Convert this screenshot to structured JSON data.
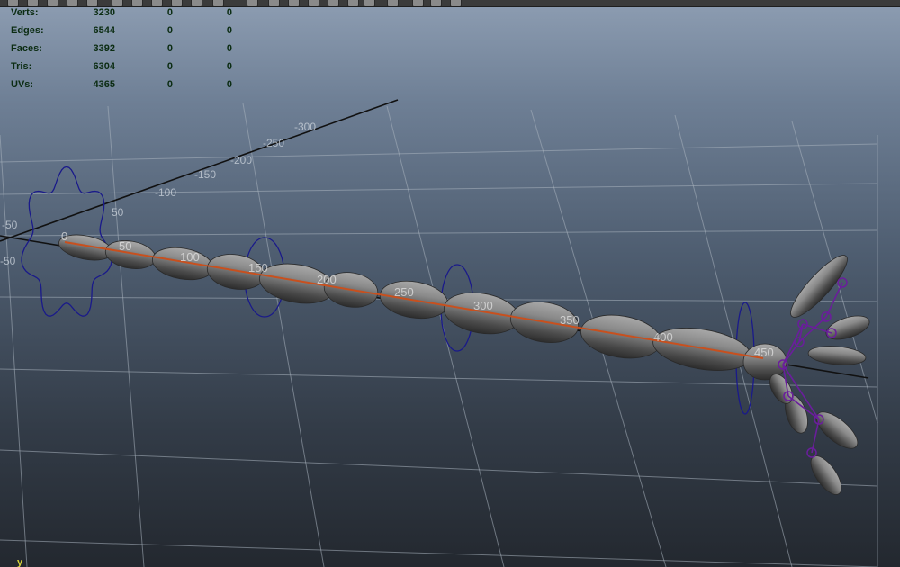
{
  "statistics": {
    "rows": [
      {
        "label": "Verts:",
        "values": [
          "3230",
          "0",
          "0"
        ]
      },
      {
        "label": "Edges:",
        "values": [
          "6544",
          "0",
          "0"
        ]
      },
      {
        "label": "Faces:",
        "values": [
          "3392",
          "0",
          "0"
        ]
      },
      {
        "label": "Tris:",
        "values": [
          "6304",
          "0",
          "0"
        ]
      },
      {
        "label": "UVs:",
        "values": [
          "4365",
          "0",
          "0"
        ]
      }
    ]
  },
  "grid_labels": [
    "-300",
    "-250",
    "-200",
    "-150",
    "-100",
    "-50",
    "-50",
    "50",
    "50"
  ],
  "bone_labels": [
    "0",
    "50",
    "100",
    "150",
    "200",
    "250",
    "300",
    "350",
    "400",
    "450"
  ],
  "axis_indicator": "y",
  "colors": {
    "statistics_text": "#0b2c12",
    "grid_line": "#a9b3be",
    "axis_line": "#111111",
    "nurbs_control": "#1a1a8a",
    "joint": "#6a1e9c",
    "bone_axis": "#c8501e",
    "mesh": "#747474"
  },
  "toolbar_icons": [
    "select-tool-icon",
    "render-icon",
    "render-settings-icon",
    "shading-icon",
    "camera-icon",
    "grid-icon",
    "wireframe-icon",
    "smooth-shade-icon",
    "texture-icon",
    "light-icon",
    "shadow-icon",
    "isolate-icon",
    "xray-icon",
    "joint-xray-icon"
  ]
}
